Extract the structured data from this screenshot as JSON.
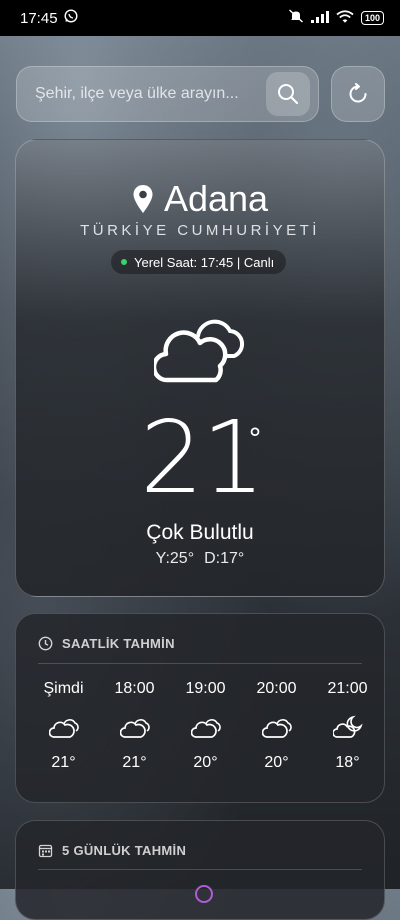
{
  "statusbar": {
    "time": "17:45",
    "battery": "100"
  },
  "search": {
    "placeholder": "Şehir, ilçe veya ülke arayın..."
  },
  "location": {
    "city": "Adana",
    "country": "TÜRKİYE CUMHURİYETİ",
    "local_time": "Yerel Saat: 17:45 | Canlı"
  },
  "current": {
    "temperature": "21",
    "degree_symbol": "°",
    "condition": "Çok Bulutlu",
    "high": "Y:25°",
    "low": "D:17°"
  },
  "hourly": {
    "title": "SAATLİK TAHMİN",
    "items": [
      {
        "label": "Şimdi",
        "temp": "21°",
        "icon": "cloud-icon"
      },
      {
        "label": "18:00",
        "temp": "21°",
        "icon": "cloud-icon"
      },
      {
        "label": "19:00",
        "temp": "20°",
        "icon": "cloud-icon"
      },
      {
        "label": "20:00",
        "temp": "20°",
        "icon": "cloud-icon"
      },
      {
        "label": "21:00",
        "temp": "18°",
        "icon": "cloud-moon-icon"
      }
    ]
  },
  "daily": {
    "title": "5 GÜNLÜK TAHMİN"
  },
  "colors": {
    "live_dot": "#39d36b",
    "accent_ring": "#b05cd6"
  }
}
